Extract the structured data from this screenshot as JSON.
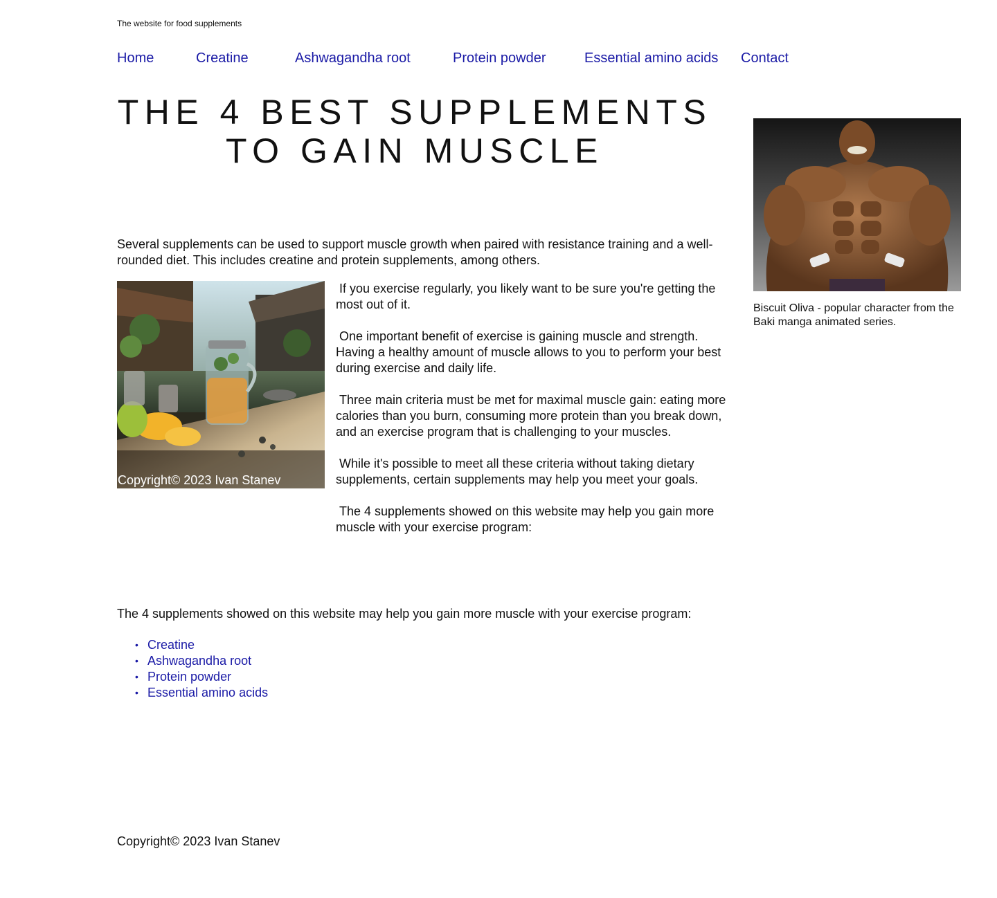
{
  "site": {
    "tagline": "The website for food supplements"
  },
  "nav": {
    "items": [
      {
        "label": "Home"
      },
      {
        "label": "Creatine"
      },
      {
        "label": "Ashwagandha root"
      },
      {
        "label": "Protein powder"
      },
      {
        "label": "Essential amino acids"
      },
      {
        "label": "Contact"
      }
    ]
  },
  "main": {
    "title_line1": "THE 4 BEST SUPPLEMENTS",
    "title_line2": "TO GAIN MUSCLE",
    "intro": "Several supplements can be used to support muscle growth when paired with resistance training and a well-rounded diet. This includes creatine and protein supplements, among others.",
    "feature_image": {
      "credit": "Copyright© 2023 Ivan Stanev"
    },
    "paragraphs": [
      " If you exercise regularly, you likely want to be sure you're getting the most out of it.",
      " One important benefit of exercise is gaining muscle and strength. Having a healthy amount of muscle allows to you to perform your best during exercise and daily life.",
      " Three main criteria must be met for maximal muscle gain: eating more calories than you burn, consuming more protein than you break down, and an exercise program that is challenging to your muscles.",
      " While it's possible to meet all these criteria without taking dietary supplements, certain supplements may help you meet your goals.",
      " The 4 supplements showed on this website may help you gain more muscle with your exercise program:"
    ],
    "list_intro": "The 4 supplements showed on this website may help you gain more muscle with your exercise program:",
    "supplements": [
      {
        "label": "Creatine"
      },
      {
        "label": "Ashwagandha root"
      },
      {
        "label": "Protein powder"
      },
      {
        "label": "Essential amino acids"
      }
    ]
  },
  "sidebar": {
    "caption": "Biscuit Oliva - popular character from the Baki manga animated series."
  },
  "footer": {
    "copyright": "Copyright© 2023 Ivan Stanev"
  },
  "colors": {
    "link": "#1a1aa6",
    "text": "#111111",
    "background": "#ffffff"
  }
}
